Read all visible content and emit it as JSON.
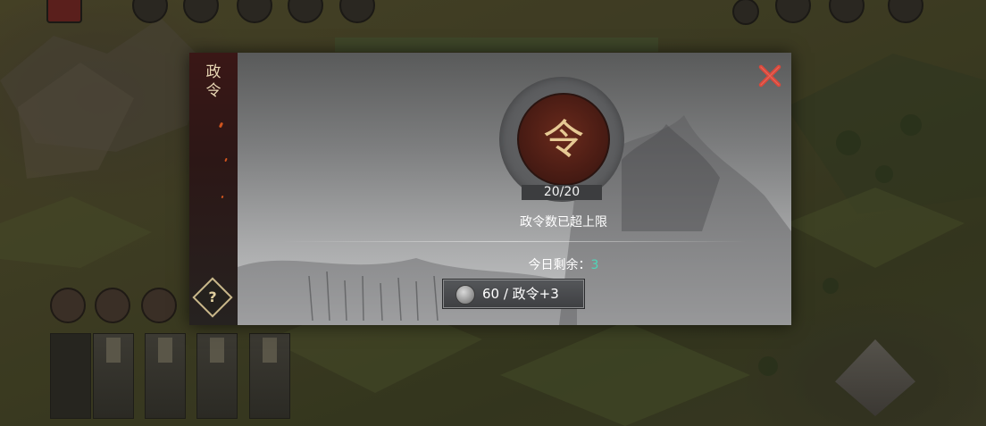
{
  "dialog": {
    "side_title": "政令",
    "help_label": "?",
    "emblem_char": "令",
    "count": "20/20",
    "limit_text": "政令数已超上限",
    "remaining_label": "今日剩余：",
    "remaining_value": "3",
    "buy_button": {
      "cost_icon": "silver-coin-icon",
      "label": "60 / 政令+3"
    },
    "close_icon": "close-x-icon"
  },
  "colors": {
    "accent_teal": "#4fd7b9",
    "close_red": "#d9483b",
    "emblem_red": "#5a2117",
    "side_panel": "#2c1716"
  },
  "background_icons": [
    "top-menu-icon",
    "side-skill-icon",
    "troop-card",
    "corner-emblem-icon"
  ]
}
